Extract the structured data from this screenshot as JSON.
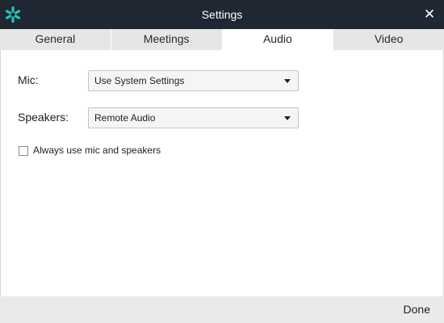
{
  "window": {
    "title": "Settings",
    "app_icon": "asterisk-logo-icon",
    "close_glyph": "✕",
    "titlebar_color": "#1f2733",
    "icon_color": "#27c2b6"
  },
  "tabs": [
    {
      "label": "General",
      "active": false
    },
    {
      "label": "Meetings",
      "active": false
    },
    {
      "label": "Audio",
      "active": true
    },
    {
      "label": "Video",
      "active": false
    }
  ],
  "audio": {
    "mic": {
      "label": "Mic:",
      "value": "Use System Settings"
    },
    "speakers": {
      "label": "Speakers:",
      "value": "Remote Audio"
    },
    "always_use": {
      "label": "Always use mic and speakers",
      "checked": false
    }
  },
  "footer": {
    "done_label": "Done"
  }
}
